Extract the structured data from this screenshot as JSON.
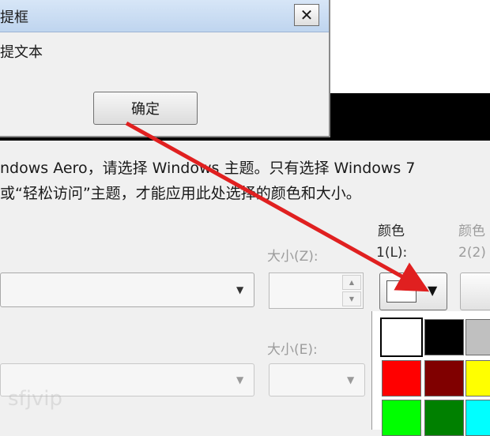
{
  "dialog": {
    "title_partial": "提框",
    "close_symbol": "✕",
    "body_partial": "提文本",
    "ok_label": "确定"
  },
  "description": {
    "line1": "ndows Aero，请选择 Windows 主题。只有选择 Windows 7",
    "line2": "或“轻松访问”主题，才能应用此处选择的颜色和大小。"
  },
  "form": {
    "size_z_label": "大小(Z):",
    "size_e_label": "大小(E):",
    "color1_label_line1": "颜色",
    "color1_label_line2": "1(L):",
    "color2_label_line1": "颜色",
    "color2_label_line2": "2(2)"
  },
  "palette": {
    "colors": [
      "#ffffff",
      "#000000",
      "#c0c0c0",
      "#ff0000",
      "#800000",
      "#ffff00",
      "#00ff00",
      "#008000",
      "#00ffff"
    ],
    "selected_index": 0
  },
  "arrow_color": "#e02020",
  "watermark": "sfjvip"
}
